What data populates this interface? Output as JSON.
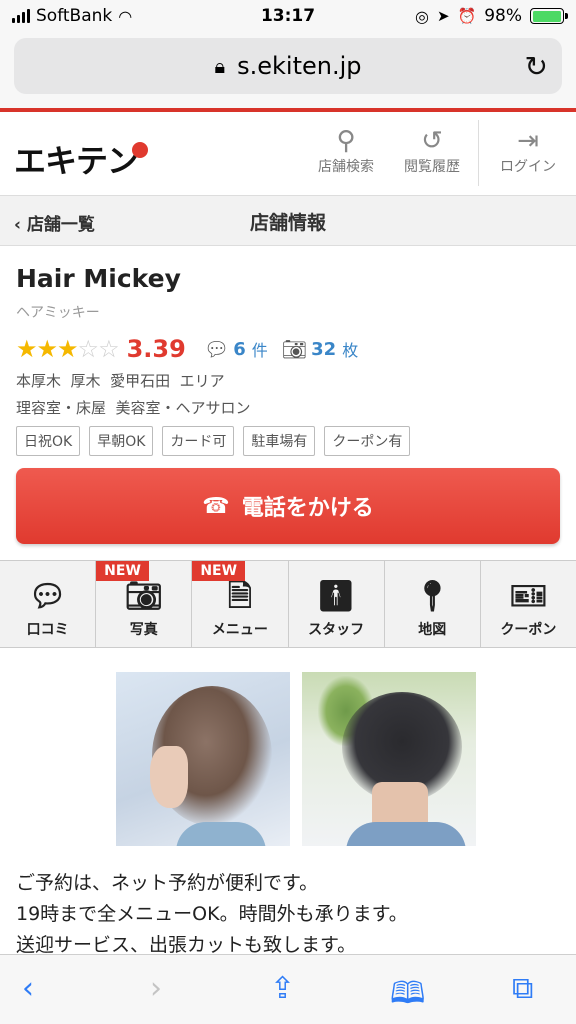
{
  "status_bar": {
    "carrier": "SoftBank",
    "time": "13:17",
    "battery_percent": "98%",
    "battery_level": 0.98
  },
  "browser": {
    "url": "s.ekiten.jp"
  },
  "header": {
    "logo_text": "エキテン",
    "nav": {
      "search": "店舗検索",
      "history": "閲覧履歴",
      "login": "ログイン"
    }
  },
  "breadcrumb": {
    "back_label": "店舗一覧",
    "title": "店舗情報"
  },
  "shop": {
    "name": "Hair Mickey",
    "kana": "ヘアミッキー",
    "rating": "3.39",
    "stars_filled": 3,
    "stars_total": 5,
    "reviews_count": "6",
    "reviews_unit": "件",
    "photos_count": "32",
    "photos_unit": "枚",
    "area": "本厚木  厚木  愛甲石田  エリア",
    "categories": "理容室・床屋  美容室・ヘアサロン",
    "tags": [
      "日祝OK",
      "早朝OK",
      "カード可",
      "駐車場有",
      "クーポン有"
    ],
    "call_label": "電話をかける"
  },
  "tabs": [
    {
      "label": "口コミ",
      "icon": "speech-bubble-icon",
      "new": ""
    },
    {
      "label": "写真",
      "icon": "camera-icon",
      "new": "NEW"
    },
    {
      "label": "メニュー",
      "icon": "document-icon",
      "new": "NEW"
    },
    {
      "label": "スタッフ",
      "icon": "person-icon",
      "new": ""
    },
    {
      "label": "地図",
      "icon": "map-pin-icon",
      "new": ""
    },
    {
      "label": "クーポン",
      "icon": "ticket-icon",
      "new": ""
    }
  ],
  "description": [
    "ご予約は、ネット予約が便利です。",
    "19時まで全メニューOK。時間外も承ります。",
    "送迎サービス、出張カットも致します。"
  ],
  "colors": {
    "accent_red": "#e03a2f",
    "link_blue": "#3a86c8",
    "star_yellow": "#f5b800",
    "ios_blue": "#2f7cf6"
  }
}
